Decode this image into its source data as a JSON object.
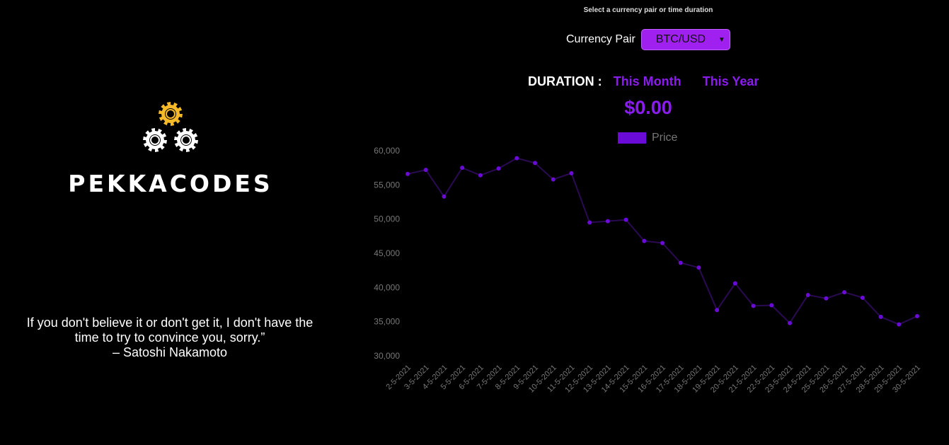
{
  "brand": {
    "name": "PEKKACODES",
    "gear_colors": [
      "#f6b928",
      "#ffffff",
      "#ffffff"
    ]
  },
  "quote": {
    "line1": "If you don't believe it or don't get it, I don't have the",
    "line2": "time to try to convince you, sorry.”",
    "author": "– Satoshi Nakamoto"
  },
  "controls": {
    "hint": "Select a currency pair or time duration",
    "pair_label": "Currency Pair",
    "pair_value": "BTC/USD",
    "duration_label": "DURATION :",
    "duration_options": [
      "This Month",
      "This Year"
    ]
  },
  "price_display": "$0.00",
  "colors": {
    "accent": "#8a1cf0",
    "series": "#6a0bd8",
    "line": "#2a0a52"
  },
  "chart_data": {
    "type": "line",
    "legend": "Price",
    "ylim": [
      30000,
      60000
    ],
    "yticks": [
      "30,000",
      "35,000",
      "40,000",
      "45,000",
      "50,000",
      "55,000",
      "60,000"
    ],
    "x": [
      "2-5-2021",
      "3-5-2021",
      "4-5-2021",
      "5-5-2021",
      "6-5-2021",
      "7-5-2021",
      "8-5-2021",
      "9-5-2021",
      "10-5-2021",
      "11-5-2021",
      "12-5-2021",
      "13-5-2021",
      "14-5-2021",
      "15-5-2021",
      "16-5-2021",
      "17-5-2021",
      "18-5-2021",
      "19-5-2021",
      "20-5-2021",
      "21-5-2021",
      "22-5-2021",
      "23-5-2021",
      "24-5-2021",
      "25-5-2021",
      "26-5-2021",
      "27-5-2021",
      "28-5-2021",
      "29-5-2021",
      "30-5-2021"
    ],
    "series": [
      {
        "name": "Price",
        "values": [
          56600,
          57200,
          53300,
          57500,
          56400,
          57400,
          58900,
          58200,
          55800,
          56700,
          49500,
          49700,
          49900,
          46800,
          46500,
          43600,
          42900,
          36700,
          40600,
          37300,
          37400,
          34800,
          38900,
          38400,
          39300,
          38500,
          35700,
          34600,
          35800
        ]
      }
    ]
  }
}
